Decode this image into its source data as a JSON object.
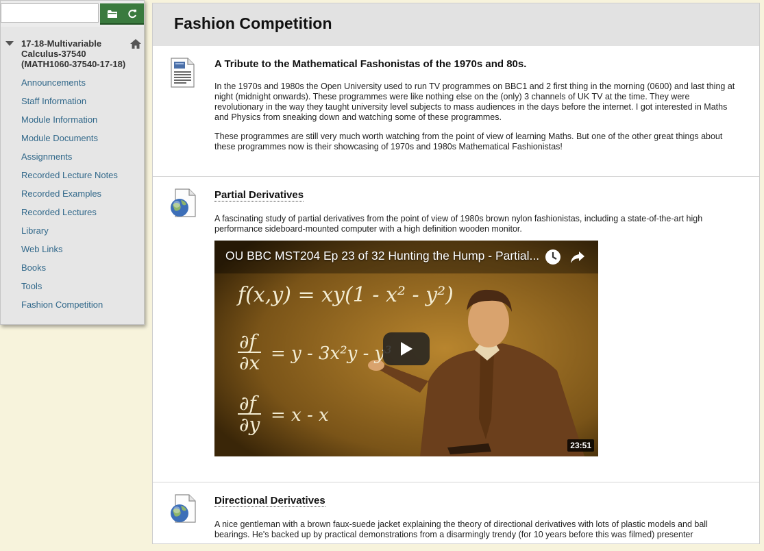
{
  "sidebar": {
    "search": {
      "placeholder": "",
      "value": ""
    },
    "course": {
      "title": "17-18-Multivariable Calculus-37540 (MATH1060-37540-17-18)"
    },
    "items": [
      {
        "label": "Announcements"
      },
      {
        "label": "Staff Information"
      },
      {
        "label": "Module Information"
      },
      {
        "label": "Module Documents"
      },
      {
        "label": "Assignments"
      },
      {
        "label": "Recorded Lecture Notes"
      },
      {
        "label": "Recorded Examples"
      },
      {
        "label": "Recorded Lectures"
      },
      {
        "label": "Library"
      },
      {
        "label": "Web Links"
      },
      {
        "label": "Books"
      },
      {
        "label": "Tools"
      },
      {
        "label": "Fashion Competition"
      }
    ]
  },
  "page": {
    "title": "Fashion Competition"
  },
  "items": [
    {
      "icon": "document-icon",
      "title": "A Tribute to the Mathematical Fashonistas of the 1970s and 80s.",
      "paragraphs": [
        "In the 1970s and 1980s the Open University used to run TV programmes on BBC1 and 2 first thing in the morning (0600) and last thing at night (midnight onwards).  These programmes were like nothing else on the (only) 3 channels of UK TV at the time.  They were revolutionary in the way they taught university level subjects to mass audiences in the days before the internet.  I got interested in Maths and Physics from sneaking down and watching some of these programmes.",
        "These programmes are still very much worth watching from the point of view of learning Maths.  But one of the other great things about these programmes now is their showcasing of 1970s and 1980s Mathematical Fashionistas!"
      ]
    },
    {
      "icon": "web-link-icon",
      "title": "Partial Derivatives",
      "description": "A fascinating study of partial derivatives from the point of view of 1980s brown nylon fashionistas, including a state-of-the-art high performance sideboard-mounted computer with a high definition wooden monitor.",
      "video": {
        "title": "OU BBC MST204 Ep 23 of 32 Hunting the Hump - Partial...",
        "duration": "23:51",
        "board_eq1": "f(x,y) = xy(1 - x² - y²)",
        "board_eq2_num": "∂f",
        "board_eq2_den": "∂x",
        "board_eq2_rhs": "= y - 3x²y - y³",
        "board_eq3_num": "∂f",
        "board_eq3_den": "∂y",
        "board_eq3_rhs": "= x - x"
      }
    },
    {
      "icon": "web-link-icon",
      "title": "Directional Derivatives",
      "description": "A nice gentleman with a brown faux-suede jacket explaining the theory of directional derivatives with lots of plastic models and ball bearings.  He's backed up by practical demonstrations from a disarmingly trendy (for 10 years before this was filmed) presenter"
    }
  ]
}
